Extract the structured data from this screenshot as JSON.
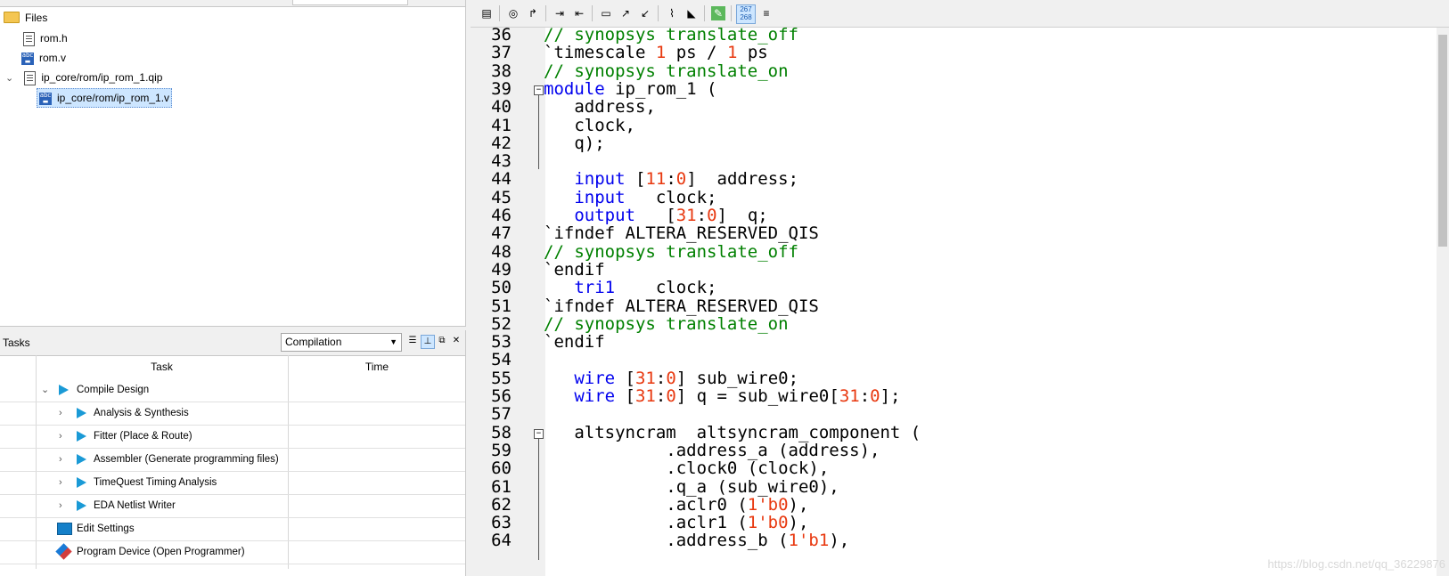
{
  "files": {
    "root_label": "Files",
    "items": [
      {
        "label": "rom.h",
        "icon": "document-icon"
      },
      {
        "label": "rom.v",
        "icon": "verilog-file-icon"
      },
      {
        "label": "ip_core/rom/ip_rom_1.qip",
        "icon": "document-icon"
      },
      {
        "label": "ip_core/rom/ip_rom_1.v",
        "icon": "verilog-file-icon"
      }
    ]
  },
  "tasks": {
    "title": "Tasks",
    "flow_value": "Compilation",
    "columns": {
      "task": "Task",
      "time": "Time"
    },
    "rows": [
      {
        "label": "Compile Design"
      },
      {
        "label": "Analysis & Synthesis"
      },
      {
        "label": "Fitter (Place & Route)"
      },
      {
        "label": "Assembler (Generate programming files)"
      },
      {
        "label": "TimeQuest Timing Analysis"
      },
      {
        "label": "EDA Netlist Writer"
      },
      {
        "label": "Edit Settings"
      },
      {
        "label": "Program Device (Open Programmer)"
      }
    ]
  },
  "editor": {
    "toolbar_badge_top": "267",
    "toolbar_badge_bottom": "268",
    "lines": [
      {
        "n": "36",
        "tokens": [
          {
            "t": "// synopsys translate_off",
            "c": "cm"
          }
        ]
      },
      {
        "n": "37",
        "tokens": [
          {
            "t": "`timescale ",
            "c": ""
          },
          {
            "t": "1",
            "c": "num"
          },
          {
            "t": " ps / ",
            "c": ""
          },
          {
            "t": "1",
            "c": "num"
          },
          {
            "t": " ps",
            "c": ""
          }
        ]
      },
      {
        "n": "38",
        "tokens": [
          {
            "t": "// synopsys translate_on",
            "c": "cm"
          }
        ]
      },
      {
        "n": "39",
        "tokens": [
          {
            "t": "module",
            "c": "kw"
          },
          {
            "t": " ip_rom_1 (",
            "c": ""
          }
        ]
      },
      {
        "n": "40",
        "tokens": [
          {
            "t": "   address,",
            "c": ""
          }
        ]
      },
      {
        "n": "41",
        "tokens": [
          {
            "t": "   clock,",
            "c": ""
          }
        ]
      },
      {
        "n": "42",
        "tokens": [
          {
            "t": "   q);",
            "c": ""
          }
        ]
      },
      {
        "n": "43",
        "tokens": [
          {
            "t": "",
            "c": ""
          }
        ]
      },
      {
        "n": "44",
        "tokens": [
          {
            "t": "   ",
            "c": ""
          },
          {
            "t": "input",
            "c": "kw"
          },
          {
            "t": " [",
            "c": ""
          },
          {
            "t": "11",
            "c": "num"
          },
          {
            "t": ":",
            "c": ""
          },
          {
            "t": "0",
            "c": "num"
          },
          {
            "t": "]  address;",
            "c": ""
          }
        ]
      },
      {
        "n": "45",
        "tokens": [
          {
            "t": "   ",
            "c": ""
          },
          {
            "t": "input",
            "c": "kw"
          },
          {
            "t": "   clock;",
            "c": ""
          }
        ]
      },
      {
        "n": "46",
        "tokens": [
          {
            "t": "   ",
            "c": ""
          },
          {
            "t": "output",
            "c": "kw"
          },
          {
            "t": "   [",
            "c": ""
          },
          {
            "t": "31",
            "c": "num"
          },
          {
            "t": ":",
            "c": ""
          },
          {
            "t": "0",
            "c": "num"
          },
          {
            "t": "]  q;",
            "c": ""
          }
        ]
      },
      {
        "n": "47",
        "tokens": [
          {
            "t": "`ifndef ALTERA_RESERVED_QIS",
            "c": ""
          }
        ]
      },
      {
        "n": "48",
        "tokens": [
          {
            "t": "// synopsys translate_off",
            "c": "cm"
          }
        ]
      },
      {
        "n": "49",
        "tokens": [
          {
            "t": "`endif",
            "c": ""
          }
        ]
      },
      {
        "n": "50",
        "tokens": [
          {
            "t": "   ",
            "c": ""
          },
          {
            "t": "tri1",
            "c": "kw"
          },
          {
            "t": "    clock;",
            "c": ""
          }
        ]
      },
      {
        "n": "51",
        "tokens": [
          {
            "t": "`ifndef ALTERA_RESERVED_QIS",
            "c": ""
          }
        ]
      },
      {
        "n": "52",
        "tokens": [
          {
            "t": "// synopsys translate_on",
            "c": "cm"
          }
        ]
      },
      {
        "n": "53",
        "tokens": [
          {
            "t": "`endif",
            "c": ""
          }
        ]
      },
      {
        "n": "54",
        "tokens": [
          {
            "t": "",
            "c": ""
          }
        ]
      },
      {
        "n": "55",
        "tokens": [
          {
            "t": "   ",
            "c": ""
          },
          {
            "t": "wire",
            "c": "kw"
          },
          {
            "t": " [",
            "c": ""
          },
          {
            "t": "31",
            "c": "num"
          },
          {
            "t": ":",
            "c": ""
          },
          {
            "t": "0",
            "c": "num"
          },
          {
            "t": "] sub_wire0;",
            "c": ""
          }
        ]
      },
      {
        "n": "56",
        "tokens": [
          {
            "t": "   ",
            "c": ""
          },
          {
            "t": "wire",
            "c": "kw"
          },
          {
            "t": " [",
            "c": ""
          },
          {
            "t": "31",
            "c": "num"
          },
          {
            "t": ":",
            "c": ""
          },
          {
            "t": "0",
            "c": "num"
          },
          {
            "t": "] q = sub_wire0[",
            "c": ""
          },
          {
            "t": "31",
            "c": "num"
          },
          {
            "t": ":",
            "c": ""
          },
          {
            "t": "0",
            "c": "num"
          },
          {
            "t": "];",
            "c": ""
          }
        ]
      },
      {
        "n": "57",
        "tokens": [
          {
            "t": "",
            "c": ""
          }
        ]
      },
      {
        "n": "58",
        "tokens": [
          {
            "t": "   altsyncram  altsyncram_component (",
            "c": ""
          }
        ]
      },
      {
        "n": "59",
        "tokens": [
          {
            "t": "            .address_a (address),",
            "c": ""
          }
        ]
      },
      {
        "n": "60",
        "tokens": [
          {
            "t": "            .clock0 (clock),",
            "c": ""
          }
        ]
      },
      {
        "n": "61",
        "tokens": [
          {
            "t": "            .q_a (sub_wire0),",
            "c": ""
          }
        ]
      },
      {
        "n": "62",
        "tokens": [
          {
            "t": "            .aclr0 (",
            "c": ""
          },
          {
            "t": "1'b0",
            "c": "num"
          },
          {
            "t": "),",
            "c": ""
          }
        ]
      },
      {
        "n": "63",
        "tokens": [
          {
            "t": "            .aclr1 (",
            "c": ""
          },
          {
            "t": "1'b0",
            "c": "num"
          },
          {
            "t": "),",
            "c": ""
          }
        ]
      },
      {
        "n": "64",
        "tokens": [
          {
            "t": "            .address_b (",
            "c": ""
          },
          {
            "t": "1'b1",
            "c": "num"
          },
          {
            "t": "),",
            "c": ""
          }
        ]
      }
    ]
  },
  "watermark": "https://blog.csdn.net/qq_36229876",
  "colors": {
    "comment": "#008000",
    "keyword": "#0000ee",
    "number": "#e8380f",
    "play": "#1a9ad6"
  }
}
